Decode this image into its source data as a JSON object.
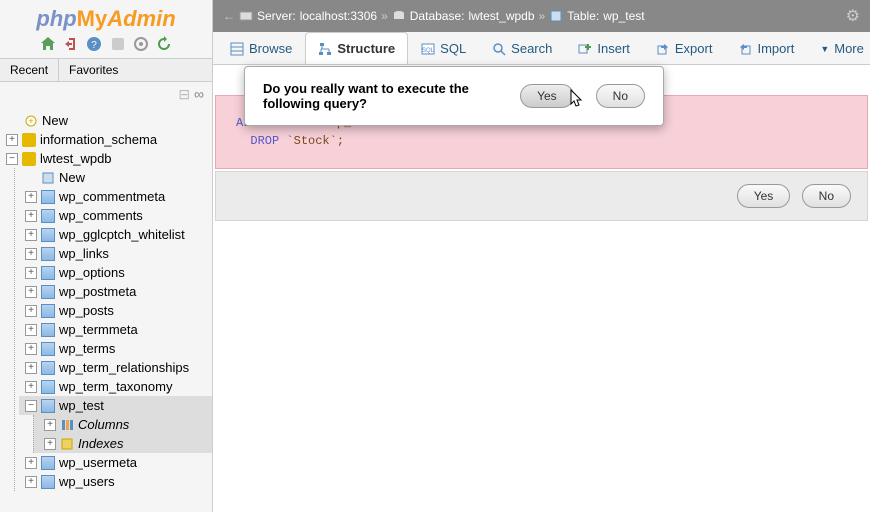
{
  "logo": {
    "php": "php",
    "my": "My",
    "admin": "Admin"
  },
  "sidebarTabs": {
    "recent": "Recent",
    "favorites": "Favorites"
  },
  "tree": {
    "new": "New",
    "db1": "information_schema",
    "db2": "lwtest_wpdb",
    "db2_new": "New",
    "tables": [
      "wp_commentmeta",
      "wp_comments",
      "wp_gglcptch_whitelist",
      "wp_links",
      "wp_options",
      "wp_postmeta",
      "wp_posts",
      "wp_termmeta",
      "wp_terms",
      "wp_term_relationships",
      "wp_term_taxonomy"
    ],
    "selectedTable": "wp_test",
    "selectedChildren": {
      "columns": "Columns",
      "indexes": "Indexes"
    },
    "tablesAfter": [
      "wp_usermeta",
      "wp_users"
    ]
  },
  "breadcrumb": {
    "server_lbl": "Server:",
    "server": "localhost:3306",
    "db_lbl": "Database:",
    "db": "lwtest_wpdb",
    "table_lbl": "Table:",
    "table": "wp_test"
  },
  "tabs": {
    "browse": "Browse",
    "structure": "Structure",
    "sql": "SQL",
    "search": "Search",
    "insert": "Insert",
    "export": "Export",
    "import": "Import",
    "more": "More"
  },
  "dialog": {
    "text": "Do you really want to execute the following query?",
    "yes": "Yes",
    "no": "No"
  },
  "sql": {
    "line1_a": "ALTER",
    "line1_b": "TABLE",
    "line1_c": "`wp_test`",
    "line2_a": "DROP",
    "line2_b": "`Stock`;"
  },
  "confirm": {
    "yes": "Yes",
    "no": "No"
  }
}
